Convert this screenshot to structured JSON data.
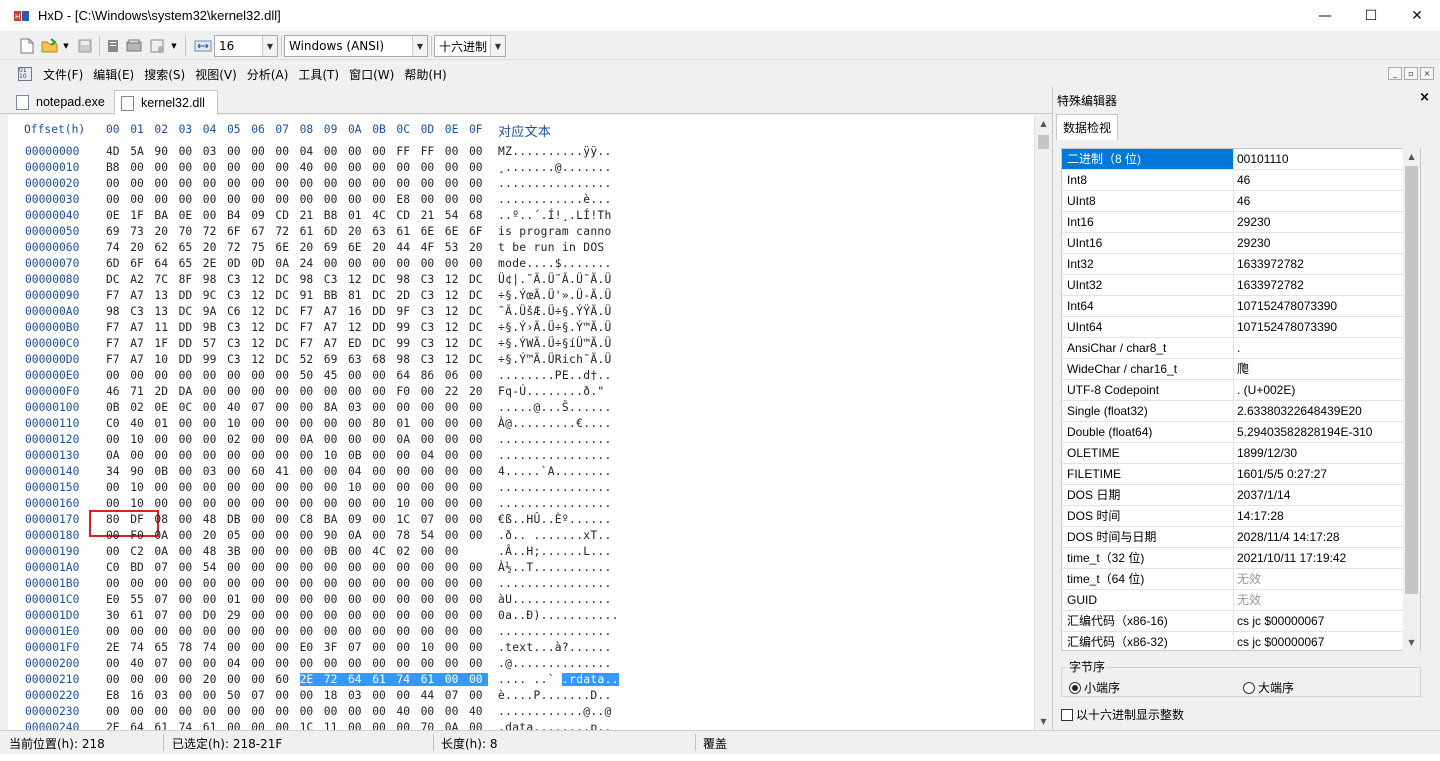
{
  "window": {
    "title": "HxD - [C:\\Windows\\system32\\kernel32.dll]",
    "minimize": "—",
    "maximize": "☐",
    "close": "✕"
  },
  "toolbar": {
    "bytes_per_row": "16",
    "charset": "Windows (ANSI)",
    "offset_base": "十六进制"
  },
  "menu": [
    "文件(F)",
    "编辑(E)",
    "搜索(S)",
    "视图(V)",
    "分析(A)",
    "工具(T)",
    "窗口(W)",
    "帮助(H)"
  ],
  "tabs": [
    {
      "label": "notepad.exe"
    },
    {
      "label": "kernel32.dll"
    }
  ],
  "hex": {
    "offset_header": "Offset(h)",
    "column_headers": [
      "00",
      "01",
      "02",
      "03",
      "04",
      "05",
      "06",
      "07",
      "08",
      "09",
      "0A",
      "0B",
      "0C",
      "0D",
      "0E",
      "0F"
    ],
    "text_header": "对应文本",
    "rows": [
      {
        "off": "00000000",
        "b": [
          "4D",
          "5A",
          "90",
          "00",
          "03",
          "00",
          "00",
          "00",
          "04",
          "00",
          "00",
          "00",
          "FF",
          "FF",
          "00",
          "00"
        ],
        "t": "MZ..........ÿÿ.."
      },
      {
        "off": "00000010",
        "b": [
          "B8",
          "00",
          "00",
          "00",
          "00",
          "00",
          "00",
          "00",
          "40",
          "00",
          "00",
          "00",
          "00",
          "00",
          "00",
          "00"
        ],
        "t": "¸.......@......."
      },
      {
        "off": "00000020",
        "b": [
          "00",
          "00",
          "00",
          "00",
          "00",
          "00",
          "00",
          "00",
          "00",
          "00",
          "00",
          "00",
          "00",
          "00",
          "00",
          "00"
        ],
        "t": "................"
      },
      {
        "off": "00000030",
        "b": [
          "00",
          "00",
          "00",
          "00",
          "00",
          "00",
          "00",
          "00",
          "00",
          "00",
          "00",
          "00",
          "E8",
          "00",
          "00",
          "00"
        ],
        "t": "............è..."
      },
      {
        "off": "00000040",
        "b": [
          "0E",
          "1F",
          "BA",
          "0E",
          "00",
          "B4",
          "09",
          "CD",
          "21",
          "B8",
          "01",
          "4C",
          "CD",
          "21",
          "54",
          "68"
        ],
        "t": "..º..´.Í!¸.LÍ!Th"
      },
      {
        "off": "00000050",
        "b": [
          "69",
          "73",
          "20",
          "70",
          "72",
          "6F",
          "67",
          "72",
          "61",
          "6D",
          "20",
          "63",
          "61",
          "6E",
          "6E",
          "6F"
        ],
        "t": "is program canno"
      },
      {
        "off": "00000060",
        "b": [
          "74",
          "20",
          "62",
          "65",
          "20",
          "72",
          "75",
          "6E",
          "20",
          "69",
          "6E",
          "20",
          "44",
          "4F",
          "53",
          "20"
        ],
        "t": "t be run in DOS "
      },
      {
        "off": "00000070",
        "b": [
          "6D",
          "6F",
          "64",
          "65",
          "2E",
          "0D",
          "0D",
          "0A",
          "24",
          "00",
          "00",
          "00",
          "00",
          "00",
          "00",
          "00"
        ],
        "t": "mode....$......."
      },
      {
        "off": "00000080",
        "b": [
          "DC",
          "A2",
          "7C",
          "8F",
          "98",
          "C3",
          "12",
          "DC",
          "98",
          "C3",
          "12",
          "DC",
          "98",
          "C3",
          "12",
          "DC"
        ],
        "t": "Ü¢|.˜Ã.Ü˜Ã.Ü˜Ã.Ü"
      },
      {
        "off": "00000090",
        "b": [
          "F7",
          "A7",
          "13",
          "DD",
          "9C",
          "C3",
          "12",
          "DC",
          "91",
          "BB",
          "81",
          "DC",
          "2D",
          "C3",
          "12",
          "DC"
        ],
        "t": "÷§.ÝœÃ.Ü'».Ü-Ã.Ü"
      },
      {
        "off": "000000A0",
        "b": [
          "98",
          "C3",
          "13",
          "DC",
          "9A",
          "C6",
          "12",
          "DC",
          "F7",
          "A7",
          "16",
          "DD",
          "9F",
          "C3",
          "12",
          "DC"
        ],
        "t": "˜Ã.ÜšÆ.Ü÷§.ÝŸÃ.Ü"
      },
      {
        "off": "000000B0",
        "b": [
          "F7",
          "A7",
          "11",
          "DD",
          "9B",
          "C3",
          "12",
          "DC",
          "F7",
          "A7",
          "12",
          "DD",
          "99",
          "C3",
          "12",
          "DC"
        ],
        "t": "÷§.Ý›Ã.Ü÷§.Ý™Ã.Ü"
      },
      {
        "off": "000000C0",
        "b": [
          "F7",
          "A7",
          "1F",
          "DD",
          "57",
          "C3",
          "12",
          "DC",
          "F7",
          "A7",
          "ED",
          "DC",
          "99",
          "C3",
          "12",
          "DC"
        ],
        "t": "÷§.ÝWÃ.Ü÷§íÜ™Ã.Ü"
      },
      {
        "off": "000000D0",
        "b": [
          "F7",
          "A7",
          "10",
          "DD",
          "99",
          "C3",
          "12",
          "DC",
          "52",
          "69",
          "63",
          "68",
          "98",
          "C3",
          "12",
          "DC"
        ],
        "t": "÷§.Ý™Ã.ÜRich˜Ã.Ü"
      },
      {
        "off": "000000E0",
        "b": [
          "00",
          "00",
          "00",
          "00",
          "00",
          "00",
          "00",
          "00",
          "50",
          "45",
          "00",
          "00",
          "64",
          "86",
          "06",
          "00"
        ],
        "t": "........PE..d†.."
      },
      {
        "off": "000000F0",
        "b": [
          "46",
          "71",
          "2D",
          "DA",
          "00",
          "00",
          "00",
          "00",
          "00",
          "00",
          "00",
          "00",
          "F0",
          "00",
          "22",
          "20"
        ],
        "t": "Fq-Ú........ð.\" "
      },
      {
        "off": "00000100",
        "b": [
          "0B",
          "02",
          "0E",
          "0C",
          "00",
          "40",
          "07",
          "00",
          "00",
          "8A",
          "03",
          "00",
          "00",
          "00",
          "00",
          "00"
        ],
        "t": ".....@...Š......"
      },
      {
        "off": "00000110",
        "b": [
          "C0",
          "40",
          "01",
          "00",
          "00",
          "10",
          "00",
          "00",
          "00",
          "00",
          "00",
          "80",
          "01",
          "00",
          "00",
          "00"
        ],
        "t": "À@.........€...."
      },
      {
        "off": "00000120",
        "b": [
          "00",
          "10",
          "00",
          "00",
          "00",
          "02",
          "00",
          "00",
          "0A",
          "00",
          "00",
          "00",
          "0A",
          "00",
          "00",
          "00"
        ],
        "t": "................"
      },
      {
        "off": "00000130",
        "b": [
          "0A",
          "00",
          "00",
          "00",
          "00",
          "00",
          "00",
          "00",
          "00",
          "10",
          "0B",
          "00",
          "00",
          "04",
          "00",
          "00"
        ],
        "t": "................"
      },
      {
        "off": "00000140",
        "b": [
          "34",
          "90",
          "0B",
          "00",
          "03",
          "00",
          "60",
          "41",
          "00",
          "00",
          "04",
          "00",
          "00",
          "00",
          "00",
          "00"
        ],
        "t": "4.....`A........"
      },
      {
        "off": "00000150",
        "b": [
          "00",
          "10",
          "00",
          "00",
          "00",
          "00",
          "00",
          "00",
          "00",
          "00",
          "10",
          "00",
          "00",
          "00",
          "00",
          "00"
        ],
        "t": "................"
      },
      {
        "off": "00000160",
        "b": [
          "00",
          "10",
          "00",
          "00",
          "00",
          "00",
          "00",
          "00",
          "00",
          "00",
          "00",
          "00",
          "10",
          "00",
          "00",
          "00"
        ],
        "t": "................"
      },
      {
        "off": "00000170",
        "b": [
          "80",
          "DF",
          "08",
          "00",
          "48",
          "DB",
          "00",
          "00",
          "C8",
          "BA",
          "09",
          "00",
          "1C",
          "07",
          "00",
          "00"
        ],
        "t": "€ß..HÛ..Èº......"
      },
      {
        "off": "00000180",
        "b": [
          "00",
          "F0",
          "0A",
          "00",
          "20",
          "05",
          "00",
          "00",
          "00",
          "90",
          "0A",
          "00",
          "78",
          "54",
          "00",
          "00"
        ],
        "t": ".ð.. .......xT.."
      },
      {
        "off": "00000190",
        "b": [
          "00",
          "C2",
          "0A",
          "00",
          "48",
          "3B",
          "00",
          "00",
          "00",
          "0B",
          "00",
          "4C",
          "02",
          "00",
          "00"
        ],
        "t": ".Â..H;......L..."
      },
      {
        "off": "000001A0",
        "b": [
          "C0",
          "BD",
          "07",
          "00",
          "54",
          "00",
          "00",
          "00",
          "00",
          "00",
          "00",
          "00",
          "00",
          "00",
          "00",
          "00"
        ],
        "t": "À½..T..........."
      },
      {
        "off": "000001B0",
        "b": [
          "00",
          "00",
          "00",
          "00",
          "00",
          "00",
          "00",
          "00",
          "00",
          "00",
          "00",
          "00",
          "00",
          "00",
          "00",
          "00"
        ],
        "t": "................"
      },
      {
        "off": "000001C0",
        "b": [
          "E0",
          "55",
          "07",
          "00",
          "00",
          "01",
          "00",
          "00",
          "00",
          "00",
          "00",
          "00",
          "00",
          "00",
          "00",
          "00"
        ],
        "t": "àU.............."
      },
      {
        "off": "000001D0",
        "b": [
          "30",
          "61",
          "07",
          "00",
          "D0",
          "29",
          "00",
          "00",
          "00",
          "00",
          "00",
          "00",
          "00",
          "00",
          "00",
          "00"
        ],
        "t": "0a..Ð)..........."
      },
      {
        "off": "000001E0",
        "b": [
          "00",
          "00",
          "00",
          "00",
          "00",
          "00",
          "00",
          "00",
          "00",
          "00",
          "00",
          "00",
          "00",
          "00",
          "00",
          "00"
        ],
        "t": "................"
      },
      {
        "off": "000001F0",
        "b": [
          "2E",
          "74",
          "65",
          "78",
          "74",
          "00",
          "00",
          "00",
          "E0",
          "3F",
          "07",
          "00",
          "00",
          "10",
          "00",
          "00"
        ],
        "t": ".text...à?......"
      },
      {
        "off": "00000200",
        "b": [
          "00",
          "40",
          "07",
          "00",
          "00",
          "04",
          "00",
          "00",
          "00",
          "00",
          "00",
          "00",
          "00",
          "00",
          "00",
          "00"
        ],
        "t": ".@.............."
      },
      {
        "off": "00000210",
        "b": [
          "00",
          "00",
          "00",
          "00",
          "20",
          "00",
          "00",
          "60",
          "2E",
          "72",
          "64",
          "61",
          "74",
          "61",
          "00",
          "00"
        ],
        "t": ".... ..`",
        "t_sel": ".rdata.."
      },
      {
        "off": "00000220",
        "b": [
          "E8",
          "16",
          "03",
          "00",
          "00",
          "50",
          "07",
          "00",
          "00",
          "18",
          "03",
          "00",
          "00",
          "44",
          "07",
          "00"
        ],
        "t": "è....P.......D.."
      },
      {
        "off": "00000230",
        "b": [
          "00",
          "00",
          "00",
          "00",
          "00",
          "00",
          "00",
          "00",
          "00",
          "00",
          "00",
          "00",
          "40",
          "00",
          "00",
          "40"
        ],
        "t": "............@..@"
      },
      {
        "off": "00000240",
        "b": [
          "2E",
          "64",
          "61",
          "74",
          "61",
          "00",
          "00",
          "00",
          "1C",
          "11",
          "00",
          "00",
          "00",
          "70",
          "0A",
          "00"
        ],
        "t": ".data........p.."
      }
    ]
  },
  "panel": {
    "title": "特殊编辑器",
    "close": "×",
    "tab": "数据检视",
    "rows": [
      {
        "k": "二进制（8 位)",
        "v": "00101110"
      },
      {
        "k": "Int8",
        "v": "46"
      },
      {
        "k": "UInt8",
        "v": "46"
      },
      {
        "k": "Int16",
        "v": "29230"
      },
      {
        "k": "UInt16",
        "v": "29230"
      },
      {
        "k": "Int32",
        "v": "1633972782"
      },
      {
        "k": "UInt32",
        "v": "1633972782"
      },
      {
        "k": "Int64",
        "v": "107152478073390"
      },
      {
        "k": "UInt64",
        "v": "107152478073390"
      },
      {
        "k": "AnsiChar / char8_t",
        "v": "."
      },
      {
        "k": "WideChar / char16_t",
        "v": "爮"
      },
      {
        "k": "UTF-8 Codepoint",
        "v": ". (U+002E)"
      },
      {
        "k": "Single (float32)",
        "v": "2.63380322648439E20"
      },
      {
        "k": "Double (float64)",
        "v": "5.29403582828194E-310"
      },
      {
        "k": "OLETIME",
        "v": "1899/12/30"
      },
      {
        "k": "FILETIME",
        "v": "1601/5/5 0:27:27"
      },
      {
        "k": "DOS 日期",
        "v": "2037/1/14"
      },
      {
        "k": "DOS 时间",
        "v": "14:17:28"
      },
      {
        "k": "DOS 时间与日期",
        "v": "2028/11/4 14:17:28"
      },
      {
        "k": "time_t（32 位)",
        "v": "2021/10/11 17:19:42"
      },
      {
        "k": "time_t（64 位)",
        "v": "无效",
        "gray": true
      },
      {
        "k": "GUID",
        "v": "无效",
        "gray": true
      },
      {
        "k": "汇编代码（x86-16)",
        "v": "cs jc $00000067"
      },
      {
        "k": "汇编代码（x86-32)",
        "v": "cs jc $00000067"
      }
    ],
    "byte_order_title": "字节序",
    "little_endian": "小端序",
    "big_endian": "大端序",
    "hex_ints_label": "以十六进制显示整数"
  },
  "status": {
    "position": "当前位置(h):  218",
    "selected": "已选定(h):  218-21F",
    "length": "长度(h):  8",
    "mode": "覆盖"
  }
}
